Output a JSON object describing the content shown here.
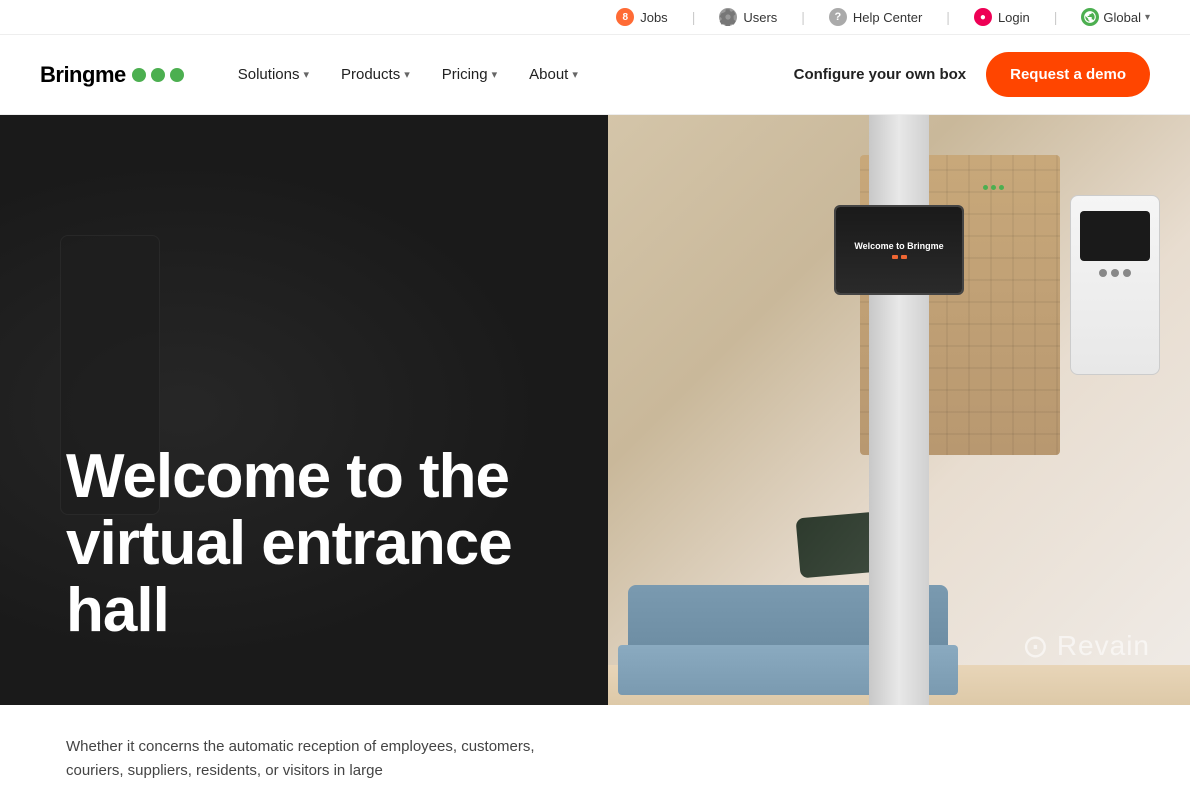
{
  "topbar": {
    "jobs_label": "Jobs",
    "jobs_badge": "8",
    "users_label": "Users",
    "help_label": "Help Center",
    "login_label": "Login",
    "global_label": "Global"
  },
  "nav": {
    "logo_text": "Bringme",
    "solutions_label": "Solutions",
    "products_label": "Products",
    "pricing_label": "Pricing",
    "about_label": "About",
    "configure_label": "Configure your own box",
    "demo_label": "Request a demo"
  },
  "hero": {
    "headline": "Welcome to the virtual entrance hall"
  },
  "body": {
    "paragraph": "Whether it concerns the automatic reception of employees, customers, couriers, suppliers, residents, or visitors in large"
  },
  "revain": {
    "text": "Revain"
  }
}
